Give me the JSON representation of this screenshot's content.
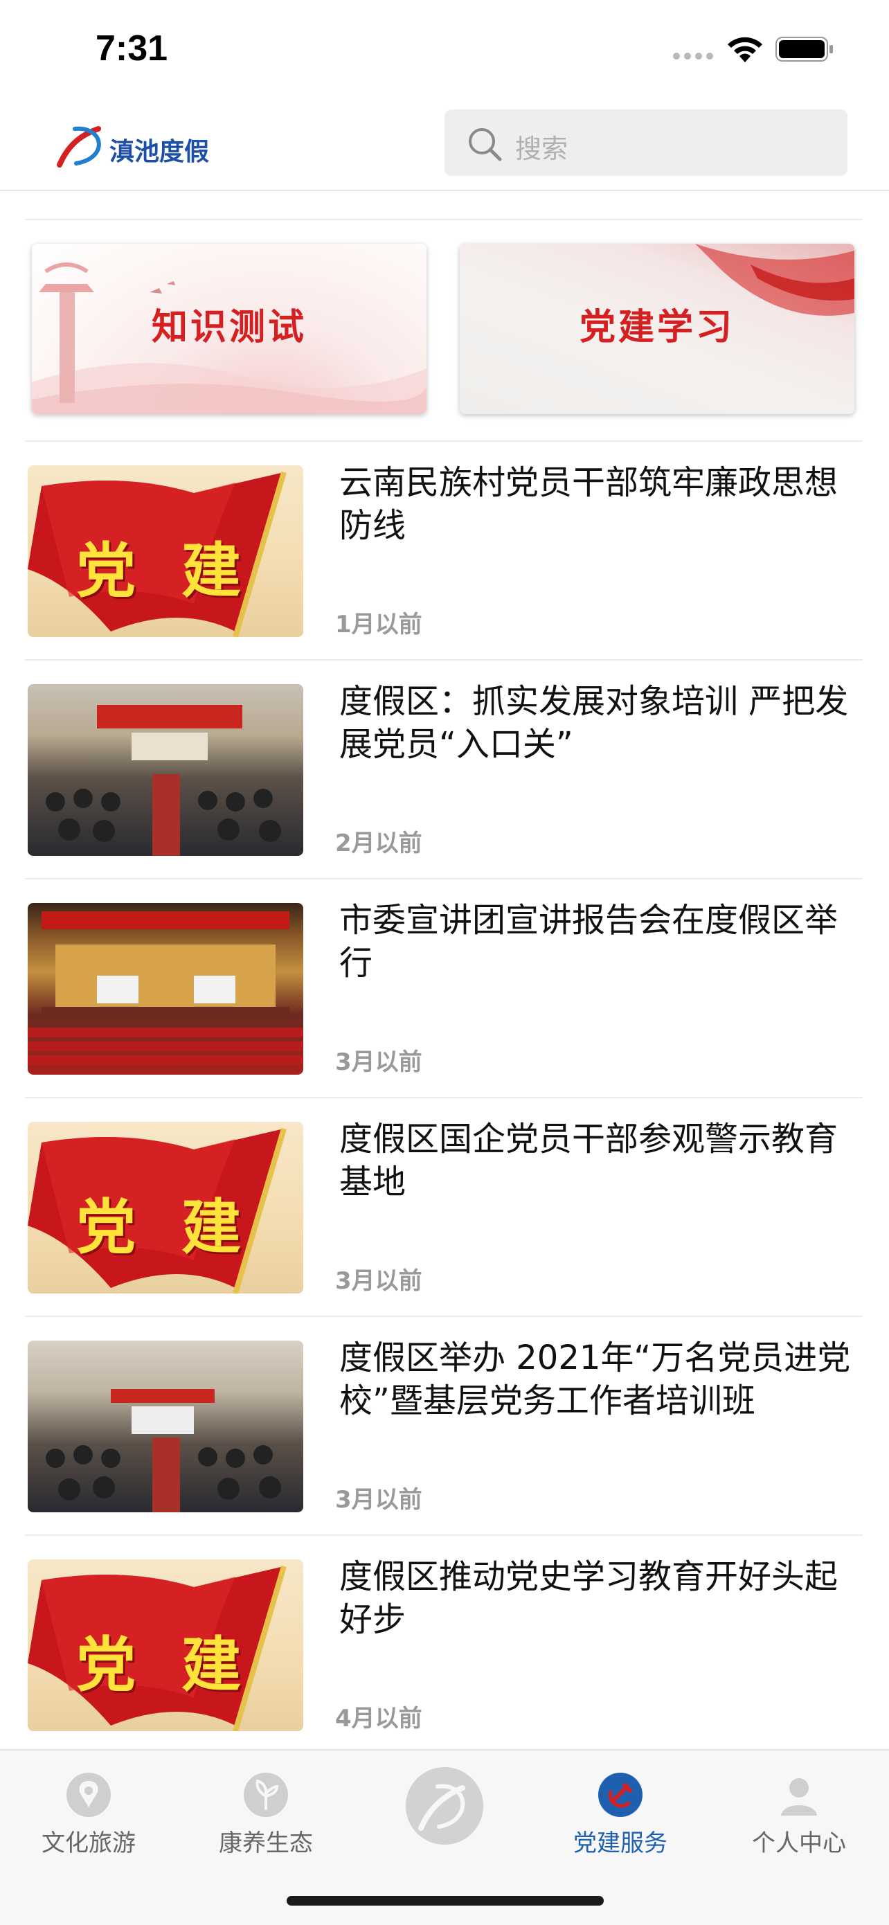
{
  "status_bar": {
    "time": "7:31"
  },
  "header": {
    "app_name": "滇池度假",
    "search_placeholder": "搜索"
  },
  "banners": [
    {
      "label": "知识测试"
    },
    {
      "label": "党建学习"
    }
  ],
  "news": [
    {
      "title": "云南民族村党员干部筑牢廉政思想防线",
      "time": "1月以前",
      "thumb": "flag",
      "thumb_text": [
        "党",
        "建"
      ]
    },
    {
      "title": "度假区：抓实发展对象培训  严把发展党员“入口关”",
      "time": "2月以前",
      "thumb": "meeting-hall"
    },
    {
      "title": "市委宣讲团宣讲报告会在度假区举行",
      "time": "3月以前",
      "thumb": "auditorium"
    },
    {
      "title": "度假区国企党员干部参观警示教育基地",
      "time": "3月以前",
      "thumb": "flag",
      "thumb_text": [
        "党",
        "建"
      ]
    },
    {
      "title": "度假区举办 2021年“万名党员进党校”暨基层党务工作者培训班",
      "time": "3月以前",
      "thumb": "meeting-hall"
    },
    {
      "title": "度假区推动党史学习教育开好头起好步",
      "time": "4月以前",
      "thumb": "flag",
      "thumb_text": [
        "党",
        "建"
      ]
    }
  ],
  "tab_bar": {
    "tabs": [
      {
        "label": "文化旅游",
        "icon": "location-pin-icon",
        "active": false
      },
      {
        "label": "康养生态",
        "icon": "leaf-icon",
        "active": false
      },
      {
        "label": "",
        "icon": "home-logo-icon",
        "active": false
      },
      {
        "label": "党建服务",
        "icon": "party-emblem-icon",
        "active": true
      },
      {
        "label": "个人中心",
        "icon": "person-icon",
        "active": false
      }
    ]
  },
  "colors": {
    "accent_blue": "#1f5fb0",
    "party_red": "#d42020",
    "time_gray": "#999999"
  }
}
